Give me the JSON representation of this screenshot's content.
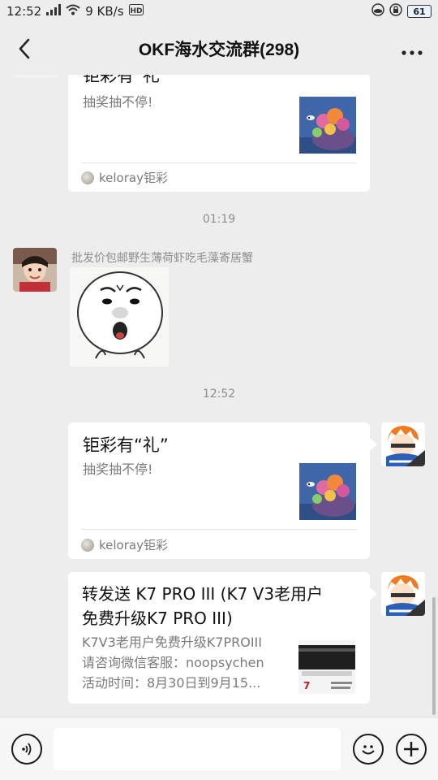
{
  "status": {
    "time": "12:52",
    "speed": "9 KB/s",
    "battery": "61"
  },
  "header": {
    "title": "OKF海水交流群(298)"
  },
  "messages": {
    "card1": {
      "title": "钜彩有“礼”",
      "desc": "抽奖抽不停!",
      "source": "keloray钜彩"
    },
    "time1": "01:19",
    "msg2": {
      "sender": "批发价包邮野生薄荷虾吃毛藻寄居蟹"
    },
    "time2": "12:52",
    "card2": {
      "title": "钜彩有“礼”",
      "desc": "抽奖抽不停!",
      "source": "keloray钜彩"
    },
    "card3": {
      "title_line1": "转发送 K7 PRO III (K7 V3老用户",
      "title_line2": "免费升级K7 PRO III)",
      "desc_line1": "K7V3老用户免费升级K7PROIII",
      "desc_line2": "请咨询微信客服：noopsychen",
      "desc_line3": "活动时间：8月30日到9月15...",
      "thumb_text": "7"
    }
  },
  "input": {
    "placeholder": ""
  },
  "colors": {
    "background": "#ededed",
    "bubble": "#ffffff",
    "secondary_text": "#7a7a7a"
  }
}
